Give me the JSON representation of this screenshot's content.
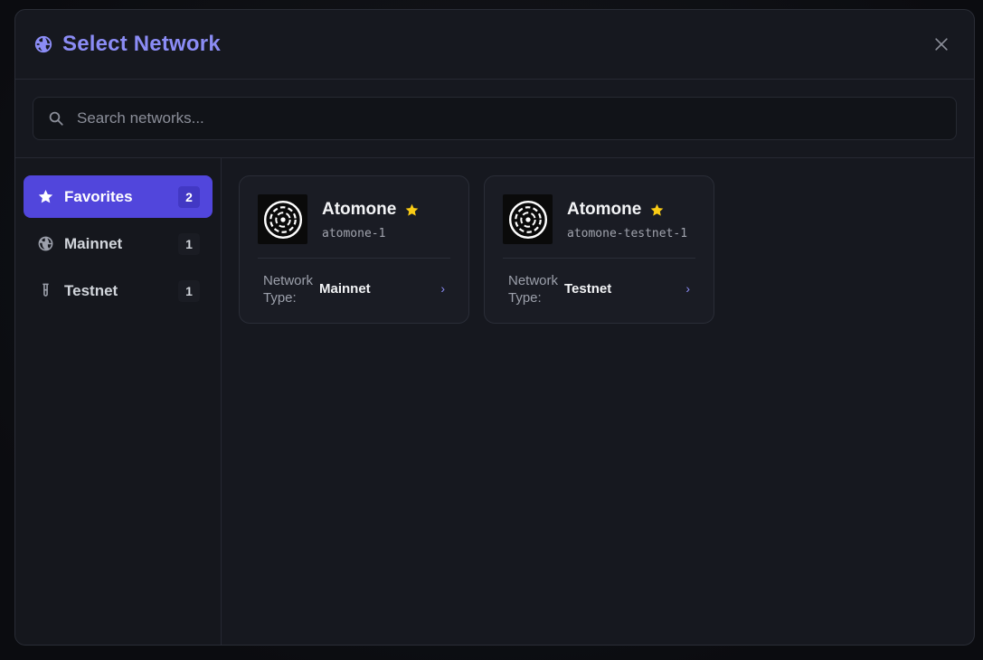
{
  "dialog": {
    "title": "Select Network",
    "icon": "globe-icon",
    "close_icon": "close-icon"
  },
  "search": {
    "placeholder": "Search networks...",
    "value": ""
  },
  "sidebar": {
    "items": [
      {
        "label": "Favorites",
        "count": "2",
        "icon": "star-icon",
        "active": true
      },
      {
        "label": "Mainnet",
        "count": "1",
        "icon": "globe-icon",
        "active": false
      },
      {
        "label": "Testnet",
        "count": "1",
        "icon": "flask-icon",
        "active": false
      }
    ]
  },
  "networks": [
    {
      "name": "Atomone",
      "chain_id": "atomone-1",
      "type_label": "Network Type:",
      "type_value": "Mainnet",
      "favorite": true
    },
    {
      "name": "Atomone",
      "chain_id": "atomone-testnet-1",
      "type_label": "Network Type:",
      "type_value": "Testnet",
      "favorite": true
    }
  ],
  "colors": {
    "accent": "#8b8cf5",
    "active_bg": "#5146dc",
    "star": "#facc15",
    "modal_bg": "#16181f"
  }
}
